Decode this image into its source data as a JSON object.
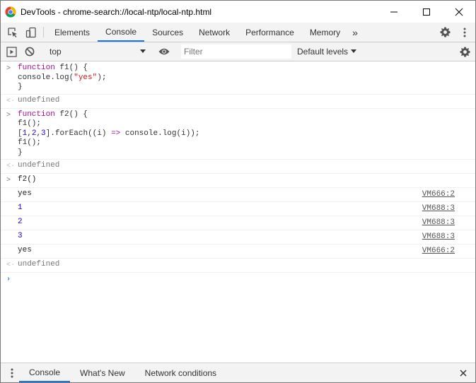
{
  "window": {
    "title": "DevTools - chrome-search://local-ntp/local-ntp.html",
    "controls": {
      "minimize": "minimize-icon",
      "maximize": "maximize-icon",
      "close": "close-icon"
    }
  },
  "tabs": [
    "Elements",
    "Console",
    "Sources",
    "Network",
    "Performance",
    "Memory"
  ],
  "tabs_more": "»",
  "toolbar": {
    "context": "top",
    "filter_placeholder": "Filter",
    "levels": "Default levels"
  },
  "console": {
    "f1_block": [
      "function f1() {",
      "console.log(\"yes\");",
      "}"
    ],
    "result1": "undefined",
    "f2_block": [
      "function f2() {",
      "f1();",
      "[1,2,3].forEach((i) => console.log(i));",
      "f1();",
      "}"
    ],
    "result2": "undefined",
    "call": "f2()",
    "logs": [
      {
        "value": "yes",
        "source": "VM666:2"
      },
      {
        "value": "1",
        "source": "VM688:3"
      },
      {
        "value": "2",
        "source": "VM688:3"
      },
      {
        "value": "3",
        "source": "VM688:3"
      },
      {
        "value": "yes",
        "source": "VM666:2"
      }
    ],
    "result3": "undefined",
    "prompt_symbol": "›"
  },
  "drawer": {
    "tabs": [
      "Console",
      "What's New",
      "Network conditions"
    ]
  },
  "colors": {
    "accent": "#1a73e8",
    "keyword": "#aa0d91",
    "string": "#c41a16",
    "number": "#1c00cf"
  }
}
